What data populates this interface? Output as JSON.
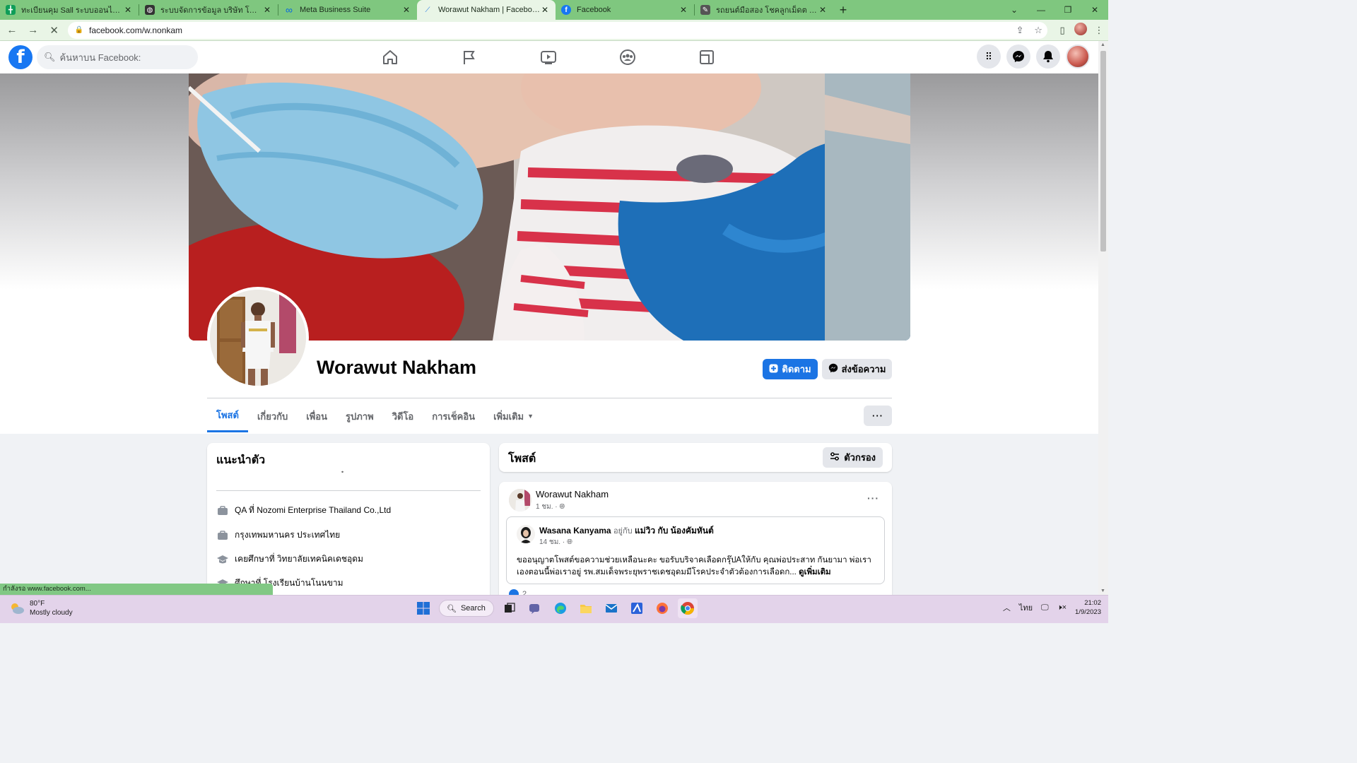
{
  "browser": {
    "tabs": [
      {
        "title": "ทะเบียนคุม Sall ระบบออนไลน์.xlsx - G",
        "fav_color": "#0f9d58",
        "fav_glyph": "╋"
      },
      {
        "title": "ระบบจัดการข้อมูล บริษัท โชคลูกเม็ดต",
        "fav_color": "#333333",
        "fav_glyph": "◍"
      },
      {
        "title": "Meta Business Suite",
        "fav_color": "#0668e1",
        "fav_glyph": "∞"
      },
      {
        "title": "Worawut Nakham | Facebook",
        "fav_color": "#1b74e4",
        "fav_glyph": "⟋"
      },
      {
        "title": "Facebook",
        "fav_color": "#1877f2",
        "fav_glyph": "f"
      },
      {
        "title": "รถยนต์มือสอง โชคลูกเม็ดต อุดรธานี",
        "fav_color": "#555555",
        "fav_glyph": "✎"
      }
    ],
    "active_tab": 3,
    "url": "facebook.com/w.nonkam",
    "status_text": "กำลังรอ www.facebook.com..."
  },
  "fb": {
    "search_placeholder": "ค้นหาบน Facebook:",
    "profile": {
      "name": "Worawut Nakham",
      "follow_label": "ติดตาม",
      "message_label": "ส่งข้อความ",
      "tabs": [
        "โพสต์",
        "เกี่ยวกับ",
        "เพื่อน",
        "รูปภาพ",
        "วิดีโอ",
        "การเช็คอิน",
        "เพิ่มเติม"
      ],
      "active_tab": 0
    },
    "intro": {
      "title": "แนะนำตัว",
      "mark": "ํ",
      "items": [
        {
          "icon": "briefcase-icon",
          "text": "QA ที่ Nozomi Enterprise Thailand Co.,Ltd"
        },
        {
          "icon": "briefcase-icon",
          "text": "กรุงเทพมหานคร ประเทศไทย"
        },
        {
          "icon": "graduation-cap-icon",
          "text": "เคยศึกษาที่ วิทยาลัยเทคนิคเดชอุดม"
        },
        {
          "icon": "graduation-cap-icon",
          "text": "ศึกษาที่ โรงเรียนบ้านโนนขาม"
        }
      ]
    },
    "posts": {
      "title": "โพสต์",
      "filter_label": "ตัวกรอง",
      "post": {
        "author": "Worawut Nakham",
        "time": "1 ชม. ·",
        "shared": {
          "author": "Wasana Kanyama",
          "with_word": "อยู่กับ",
          "with_names": "แม่วิว กับ น้องคัมหันต์",
          "time": "14 ชม. ·",
          "text": "ขออนุญาตโพสต์ขอความช่วยเหลือนะคะ ขอรับบริจาคเลือดกรุ๊ปAให้กับ คุณพ่อประสาท กันยามา พ่อเราเองตอนนี้พ่อเราอยู่ รพ.สมเด็จพระยุพราชเดชอุดมมีโรคประจำตัวต้องการเลือดก...",
          "see_more": "ดูเพิ่มเติม"
        },
        "reactions": "2"
      }
    }
  },
  "taskbar": {
    "weather_temp": "80°F",
    "weather_desc": "Mostly cloudy",
    "search_label": "Search",
    "lang": "ไทย",
    "time": "21:02",
    "date": "1/9/2023"
  },
  "colors": {
    "fb_blue": "#1b74e4",
    "chrome_green": "#7fc77f",
    "taskbar": "#e3d3ea"
  }
}
